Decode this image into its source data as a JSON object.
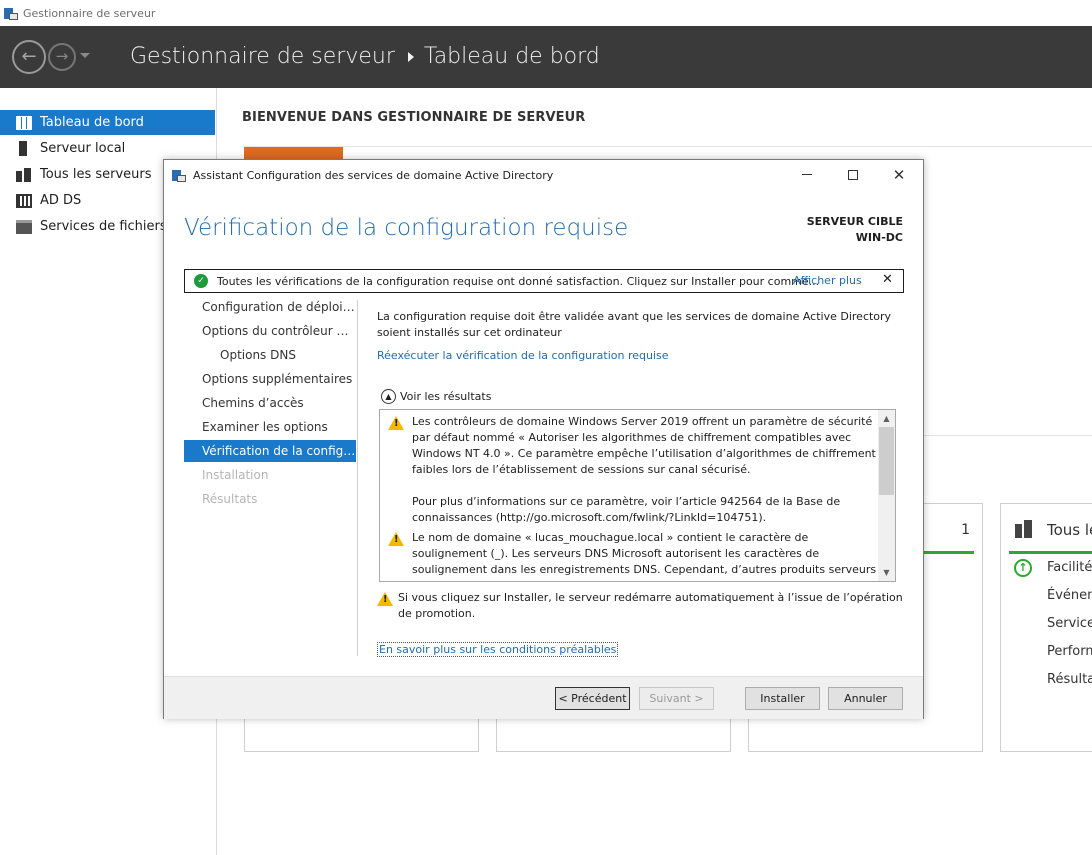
{
  "app": {
    "window_title": "Gestionnaire de serveur",
    "breadcrumb": [
      "Gestionnaire de serveur",
      "Tableau de bord"
    ]
  },
  "sidebar": {
    "items": [
      {
        "label": "Tableau de bord",
        "icon": "dashboard-icon",
        "active": true
      },
      {
        "label": "Serveur local",
        "icon": "server-icon"
      },
      {
        "label": "Tous les serveurs",
        "icon": "servers-icon"
      },
      {
        "label": "AD DS",
        "icon": "adds-icon"
      },
      {
        "label": "Services de fichiers et",
        "icon": "file-services-icon"
      }
    ]
  },
  "main": {
    "welcome": "BIENVENUE DANS GESTIONNAIRE DE SERVEUR",
    "tiles": {
      "tile3_count": "1",
      "tile4_title": "Tous le",
      "tile4_rows": [
        "Facilité",
        "Événem",
        "Services",
        "Perform",
        "Résultat"
      ]
    }
  },
  "dialog": {
    "title": "Assistant Configuration des services de domaine Active Directory",
    "heading": "Vérification de la configuration requise",
    "target_server_label": "SERVEUR CIBLE",
    "target_server_name": "WIN-DC",
    "notification": {
      "text": "Toutes les vérifications de la configuration requise ont donné satisfaction. Cliquez sur Installer pour comme...",
      "link": "Afficher plus",
      "close": "✕"
    },
    "steps": [
      {
        "label": "Configuration de déploie...",
        "state": "normal",
        "sub": false
      },
      {
        "label": "Options du contrôleur de...",
        "state": "normal",
        "sub": false
      },
      {
        "label": "Options DNS",
        "state": "normal",
        "sub": true
      },
      {
        "label": "Options supplémentaires",
        "state": "normal",
        "sub": false
      },
      {
        "label": "Chemins d’accès",
        "state": "normal",
        "sub": false
      },
      {
        "label": "Examiner les options",
        "state": "normal",
        "sub": false
      },
      {
        "label": "Vérification de la configur...",
        "state": "active",
        "sub": false
      },
      {
        "label": "Installation",
        "state": "disabled",
        "sub": false
      },
      {
        "label": "Résultats",
        "state": "disabled",
        "sub": false
      }
    ],
    "intro": "La configuration requise doit être validée avant que les services de domaine Active Directory soient installés sur cet ordinateur",
    "rerun_link": "Réexécuter la vérification de la configuration requise",
    "results_toggle": "Voir les résultats",
    "results": [
      {
        "text": "Les contrôleurs de domaine Windows Server 2019 offrent un paramètre de sécurité par défaut nommé « Autoriser les algorithmes de chiffrement compatibles avec Windows NT 4.0 ». Ce paramètre empêche l’utilisation d’algorithmes de chiffrement faibles lors de l’établissement de sessions sur canal sécurisé.",
        "icon": "warning-icon"
      },
      {
        "text": "Pour plus d’informations sur ce paramètre, voir l’article 942564 de la Base de connaissances (http://go.microsoft.com/fwlink/?LinkId=104751).",
        "icon": ""
      },
      {
        "text": "Le nom de domaine « lucas_mouchague.local » contient le caractère de soulignement (_). Les serveurs DNS Microsoft autorisent les caractères de soulignement dans les enregistrements DNS. Cependant, d’autres produits serveurs DNS pourraient ne pas les prendre en charge.",
        "icon": "warning-icon"
      }
    ],
    "restart_note": "Si vous cliquez sur Installer, le serveur redémarre automatiquement à l’issue de l’opération de promotion.",
    "prereq_link": "En savoir plus sur les conditions préalables",
    "buttons": {
      "previous": "< Précédent",
      "next": "Suivant >",
      "install": "Installer",
      "cancel": "Annuler"
    }
  },
  "colors": {
    "header_bg": "#3a3a3a",
    "accent_blue": "#1979ca",
    "heading_blue": "#1f6cad",
    "orange": "#e06a1f",
    "green": "#2fa82f",
    "warning": "#f2b900"
  }
}
